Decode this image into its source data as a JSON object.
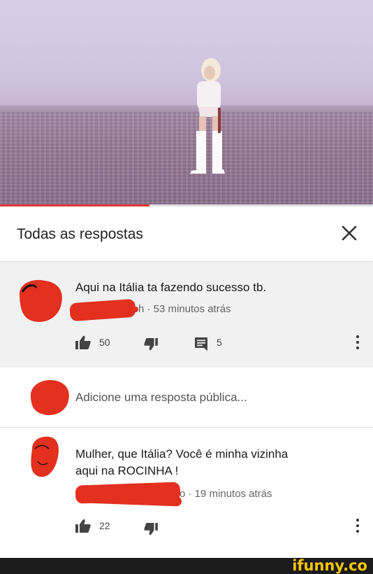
{
  "header": {
    "title": "Todas as respostas"
  },
  "video": {
    "progress": 0.4
  },
  "comments": [
    {
      "text": "Aqui na Itália ta fazendo sucesso tb.",
      "meta_suffix": "h · 53 minutos atrás",
      "likes": "50",
      "replies": "5"
    },
    {
      "text_line1": "Mulher, que Itália? Você é minha vizinha",
      "text_line2": "aqui na ROCINHA !",
      "meta_suffix": "o · 19 minutos atrás",
      "likes": "22"
    }
  ],
  "reply_box": {
    "placeholder": "Adicione uma resposta pública..."
  },
  "footer": {
    "brand": "ifunny.co"
  },
  "colors": {
    "redaction": "#e3301f",
    "progress": "#e53935",
    "brand": "#f7c600"
  }
}
